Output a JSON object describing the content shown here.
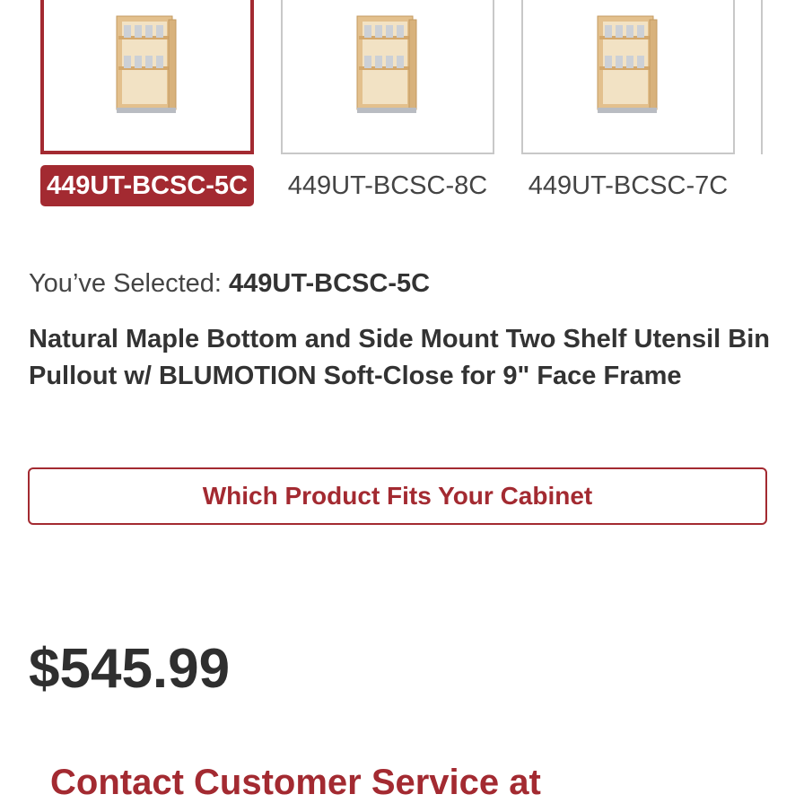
{
  "variants": [
    {
      "sku": "449UT-BCSC-5C",
      "selected": true,
      "image_icon": "pullout-cabinet-icon"
    },
    {
      "sku": "449UT-BCSC-8C",
      "selected": false,
      "image_icon": "pullout-cabinet-icon"
    },
    {
      "sku": "449UT-BCSC-7C",
      "selected": false,
      "image_icon": "pullout-cabinet-icon"
    }
  ],
  "selection": {
    "prefix": "You’ve Selected: ",
    "sku": "449UT-BCSC-5C"
  },
  "product": {
    "title": "Natural Maple Bottom and Side Mount Two Shelf Utensil Bin Pullout w/ BLUMOTION Soft-Close for 9\" Face Frame"
  },
  "fit_button": {
    "label": "Which Product Fits Your Cabinet"
  },
  "price": "$545.99",
  "contact_text": "Contact Customer Service at",
  "colors": {
    "accent": "#a32a31",
    "text": "#333333",
    "border": "#c8c8c8"
  }
}
